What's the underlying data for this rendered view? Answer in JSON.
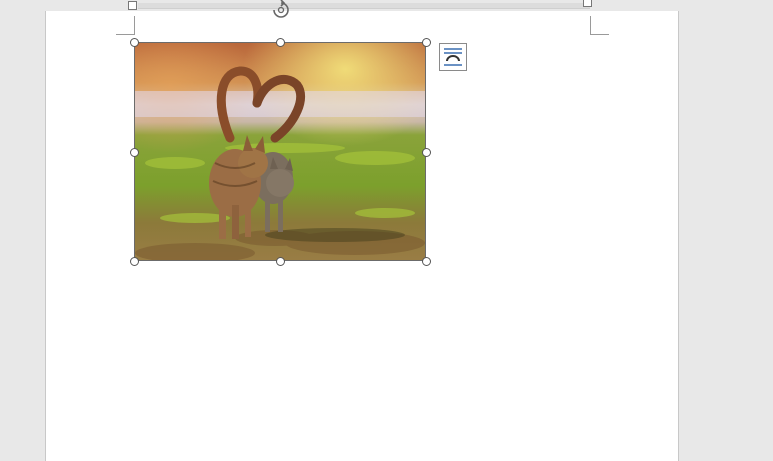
{
  "document": {
    "ruler": {
      "visible": true
    },
    "selected_image": {
      "subject": "two-cats-walking-tails-heart-photo",
      "selected": true
    },
    "layout_options": {
      "icon": "layout-options-icon"
    },
    "colors": {
      "workspace": "#e8e8e8",
      "page": "#ffffff",
      "handle_border": "#555555"
    }
  }
}
